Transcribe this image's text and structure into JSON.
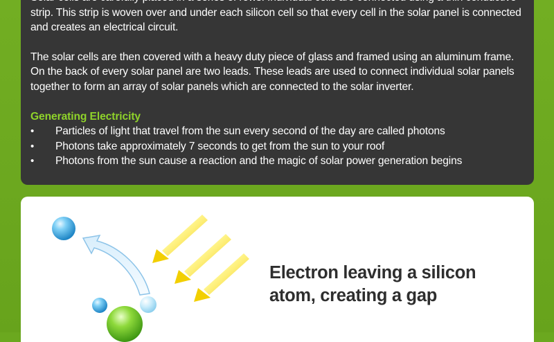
{
  "article": {
    "paragraph_1": "Solar cells are carefully placed in a series of rows. Individual cells are connected using a thin conductive strip. This strip is woven over and under each silicon cell so that every cell in the solar panel is connected and creates an electrical circuit.",
    "paragraph_2": "The solar cells are then covered with a heavy duty piece of glass and framed using an aluminum frame. On the back of every solar panel are two leads. These leads are used to connect individual solar panels together to form an array of solar panels which are connected to the solar inverter.",
    "section_heading": "Generating Electricity",
    "bullet_symbol": "•",
    "bullets": [
      "Particles of light that travel from the sun every second of the day are called photons",
      "Photons take approximately 7 seconds to get from the sun to your roof",
      "Photons from the sun cause a reaction and the magic of solar power generation begins"
    ]
  },
  "diagram": {
    "caption": "Electron leaving a silicon atom, creating a gap",
    "icons": [
      "electron-sphere-icon",
      "curved-arrow-icon",
      "photon-ray-icon",
      "silicon-atom-icon"
    ]
  },
  "colors": {
    "page_background": "#6ba81f",
    "dark_panel": "#363636",
    "heading_green": "#8fd32a",
    "body_text": "#ffffff",
    "caption_text": "#2e2e2e",
    "electron_blue": "#3fa9e0",
    "atom_green": "#6cc21e",
    "photon_yellow": "#f2d600"
  }
}
